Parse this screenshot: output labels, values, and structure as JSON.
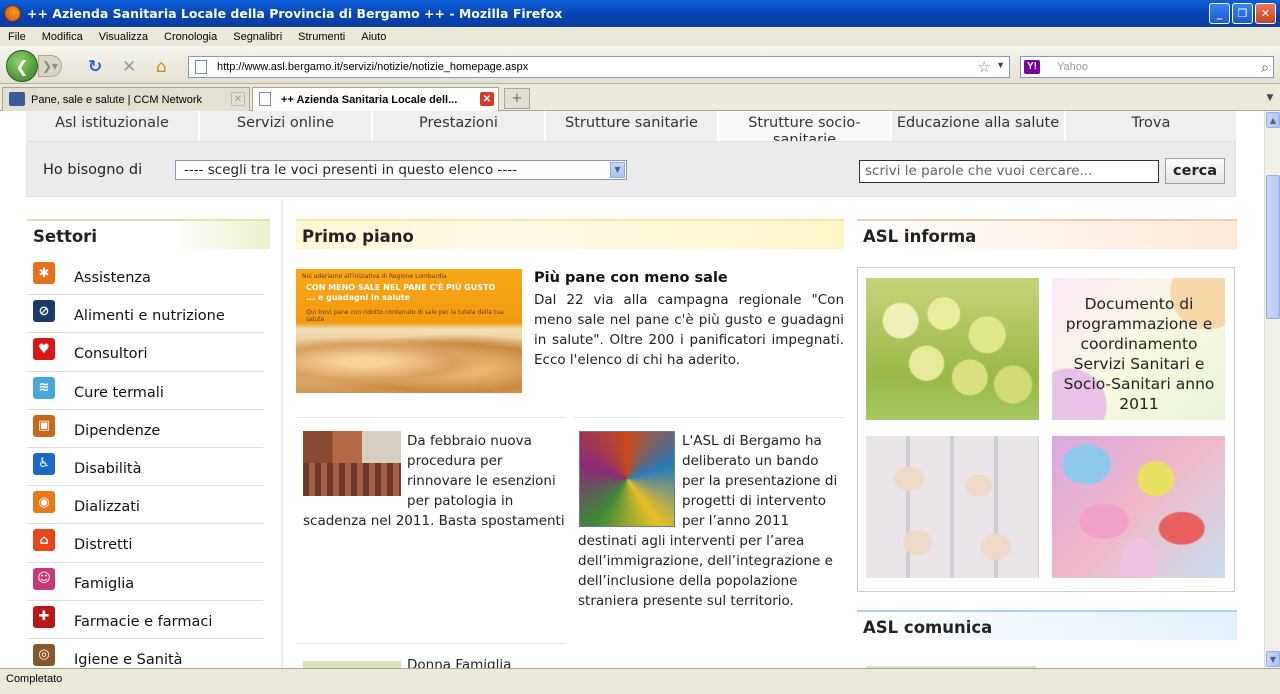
{
  "browser": {
    "title": "++ Azienda Sanitaria Locale della Provincia di Bergamo ++ - Mozilla Firefox",
    "menu": [
      "File",
      "Modifica",
      "Visualizza",
      "Cronologia",
      "Segnalibri",
      "Strumenti",
      "Aiuto"
    ],
    "url": "http://www.asl.bergamo.it/servizi/notizie/notizie_homepage.aspx",
    "search_placeholder": "Yahoo",
    "search_engine": "Y!",
    "tabs": [
      {
        "label": "Pane, sale e salute | CCM Network",
        "active": false
      },
      {
        "label": "++ Azienda Sanitaria Locale dell...",
        "active": true
      }
    ],
    "status": "Completato"
  },
  "site": {
    "nav": [
      "Asl istituzionale",
      "Servizi online",
      "Prestazioni",
      "Strutture sanitarie",
      "Strutture socio-sanitarie",
      "Educazione alla salute",
      "Trova"
    ],
    "search": {
      "label": "Ho bisogno di",
      "select_value": "---- scegli tra le voci presenti in questo elenco ----",
      "keyword_placeholder": "scrivi le parole che vuoi cercare...",
      "button": "cerca"
    },
    "settori": {
      "title": "Settori",
      "items": [
        {
          "label": "Assistenza",
          "color": "#e8701a",
          "glyph": "✱"
        },
        {
          "label": "Alimenti e nutrizione",
          "color": "#1a3a6a",
          "glyph": "⊘"
        },
        {
          "label": "Consultori",
          "color": "#d81818",
          "glyph": "♥"
        },
        {
          "label": "Cure termali",
          "color": "#4aa8d8",
          "glyph": "≋"
        },
        {
          "label": "Dipendenze",
          "color": "#c86818",
          "glyph": "▣"
        },
        {
          "label": "Disabilità",
          "color": "#1a68c8",
          "glyph": "♿"
        },
        {
          "label": "Dializzati",
          "color": "#e87818",
          "glyph": "◉"
        },
        {
          "label": "Distretti",
          "color": "#e84818",
          "glyph": "⌂"
        },
        {
          "label": "Famiglia",
          "color": "#c83878",
          "glyph": "☺"
        },
        {
          "label": "Farmacie e farmaci",
          "color": "#b81818",
          "glyph": "✚"
        },
        {
          "label": "Igiene e Sanità",
          "color": "#8a5828",
          "glyph": "◎"
        }
      ]
    },
    "primo_piano": {
      "title": "Primo piano",
      "image_lines": [
        "Noi aderiamo all'iniziativa di Regione Lombardia",
        "CON MENO SALE NEL PANE C'È PIÙ GUSTO ... e guadagni in salute",
        "Qui trovi pane con ridotto contenuto di sale per la tutela della tua salute"
      ],
      "main": {
        "title": "Più pane con meno sale",
        "text": "Dal 22 via alla campagna regionale \"Con meno sale nel pane c'è più gusto e guadagni in salute\". Oltre 200 i panificatori impegnati. Ecco l'elenco di chi ha aderito."
      },
      "news1": "Da febbraio nuova procedura per rinnovare le esenzioni per patologia in scadenza nel 2011. Basta spostamenti",
      "news2": "L'ASL di Bergamo ha deliberato un bando per la presentazione di progetti di intervento per l’anno 2011 destinati agli interventi per l’area dell’immigrazione, dell’integrazione e dell’inclusione della popolazione straniera presente sul territorio.",
      "news3": "Donna Famiglia"
    },
    "asl_informa": {
      "title": "ASL informa",
      "doc_text": "Documento di programmazione e coordinamento Servizi Sanitari e Socio-Sanitari anno 2011"
    },
    "asl_comunica": {
      "title": "ASL comunica"
    }
  }
}
